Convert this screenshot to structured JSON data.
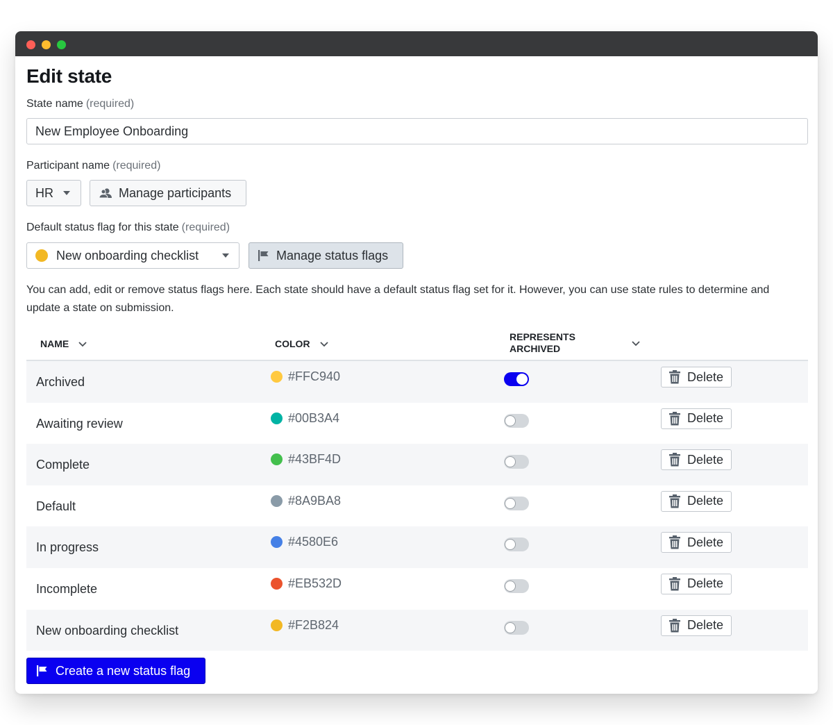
{
  "window": {
    "controls": [
      "close",
      "minimize",
      "maximize"
    ]
  },
  "page": {
    "title": "Edit state"
  },
  "state_name": {
    "label": "State name",
    "required": "(required)",
    "value": "New Employee Onboarding"
  },
  "participant": {
    "label": "Participant name",
    "required": "(required)",
    "selected": "HR",
    "manage_label": "Manage participants"
  },
  "default_flag": {
    "label": "Default status flag for this state",
    "required": "(required)",
    "selected": "New onboarding checklist",
    "selected_color": "#F2B824",
    "manage_label": "Manage status flags"
  },
  "help_text": "You can add, edit or remove status flags here. Each state should have a default status flag set for it. However, you can use state rules to determine and update a state on submission.",
  "table": {
    "columns": {
      "name": "NAME",
      "color": "COLOR",
      "archived_line1": "REPRESENTS",
      "archived_line2": "ARCHIVED"
    },
    "delete_label": "Delete",
    "rows": [
      {
        "name": "Archived",
        "color": "#FFC940",
        "archived": true
      },
      {
        "name": "Awaiting review",
        "color": "#00B3A4",
        "archived": false
      },
      {
        "name": "Complete",
        "color": "#43BF4D",
        "archived": false
      },
      {
        "name": "Default",
        "color": "#8A9BA8",
        "archived": false
      },
      {
        "name": "In progress",
        "color": "#4580E6",
        "archived": false
      },
      {
        "name": "Incomplete",
        "color": "#EB532D",
        "archived": false
      },
      {
        "name": "New onboarding checklist",
        "color": "#F2B824",
        "archived": false
      }
    ]
  },
  "create_button": "Create a new status flag",
  "accent_color": "#0A00F0"
}
